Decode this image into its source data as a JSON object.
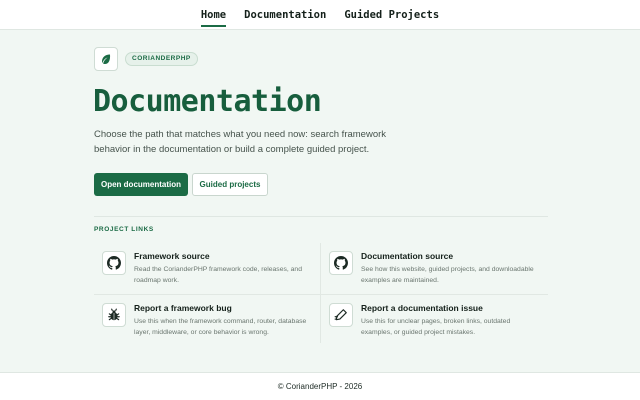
{
  "nav": {
    "items": [
      "Home",
      "Documentation",
      "Guided Projects"
    ],
    "active": "Home"
  },
  "brand": {
    "badge": "CORIANDERPHP",
    "logo_icon": "leaf-icon",
    "accent_color": "#1b6b45"
  },
  "hero": {
    "title": "Documentation",
    "lead": "Choose the path that matches what you need now: search framework behavior in the documentation or build a complete guided project.",
    "primary_button": "Open documentation",
    "secondary_button": "Guided projects"
  },
  "links_section": {
    "label": "PROJECT LINKS",
    "items": [
      {
        "icon": "github-icon",
        "title": "Framework source",
        "description": "Read the CorianderPHP framework code, releases, and roadmap work."
      },
      {
        "icon": "github-icon",
        "title": "Documentation source",
        "description": "See how this website, guided projects, and downloadable examples are maintained."
      },
      {
        "icon": "bug-icon",
        "title": "Report a framework bug",
        "description": "Use this when the framework command, router, database layer, middleware, or core behavior is wrong."
      },
      {
        "icon": "pencil-icon",
        "title": "Report a documentation issue",
        "description": "Use this for unclear pages, broken links, outdated examples, or guided project mistakes."
      }
    ]
  },
  "footer": {
    "text": "© CorianderPHP - 2026"
  }
}
